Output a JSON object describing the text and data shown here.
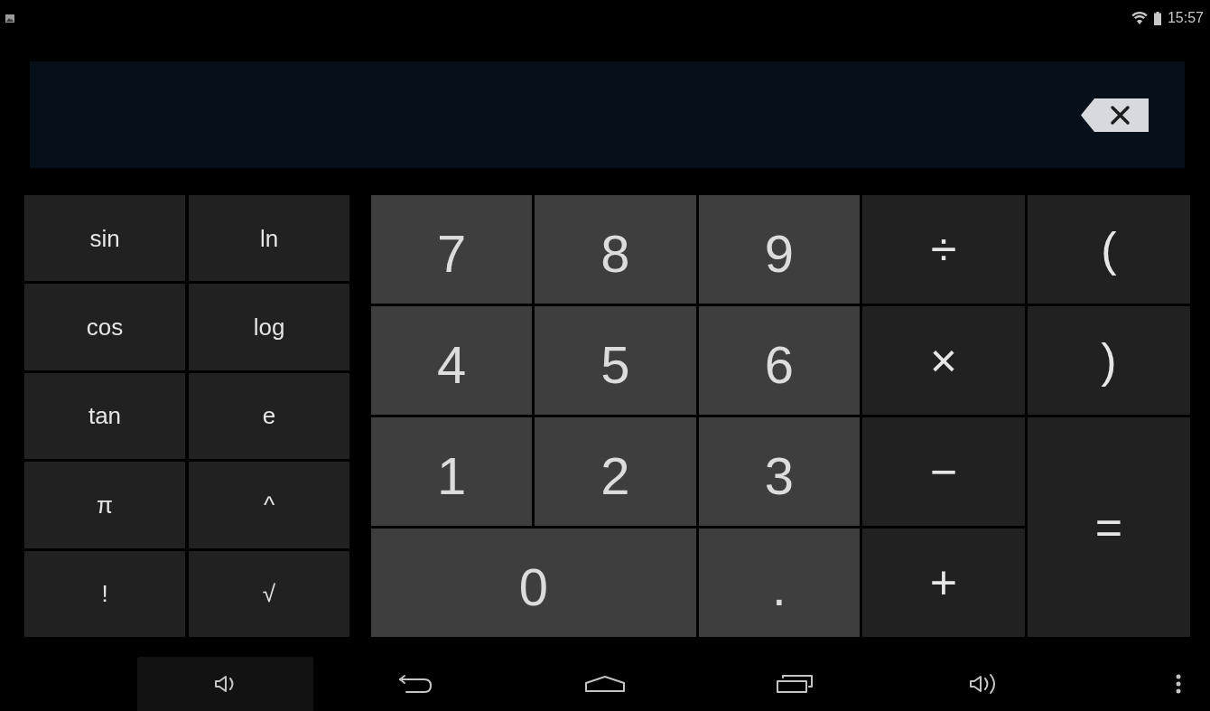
{
  "status_bar": {
    "time": "15:57"
  },
  "function_keys": [
    [
      "sin",
      "ln"
    ],
    [
      "cos",
      "log"
    ],
    [
      "tan",
      "e"
    ],
    [
      "π",
      "^"
    ],
    [
      "!",
      "√"
    ]
  ],
  "number_keys": [
    [
      "7",
      "8",
      "9"
    ],
    [
      "4",
      "5",
      "6"
    ],
    [
      "1",
      "2",
      "3"
    ],
    [
      "0",
      "."
    ]
  ],
  "operator_keys": [
    [
      "÷",
      "("
    ],
    [
      "×",
      ")"
    ],
    [
      "−",
      "="
    ],
    [
      "+"
    ]
  ],
  "nav_bar": [
    {
      "kind": "volume-down",
      "highlighted": true
    },
    {
      "kind": "back",
      "highlighted": false
    },
    {
      "kind": "home",
      "highlighted": false
    },
    {
      "kind": "recents",
      "highlighted": false
    },
    {
      "kind": "volume-up",
      "highlighted": false
    },
    {
      "kind": "menu",
      "highlighted": false
    }
  ]
}
